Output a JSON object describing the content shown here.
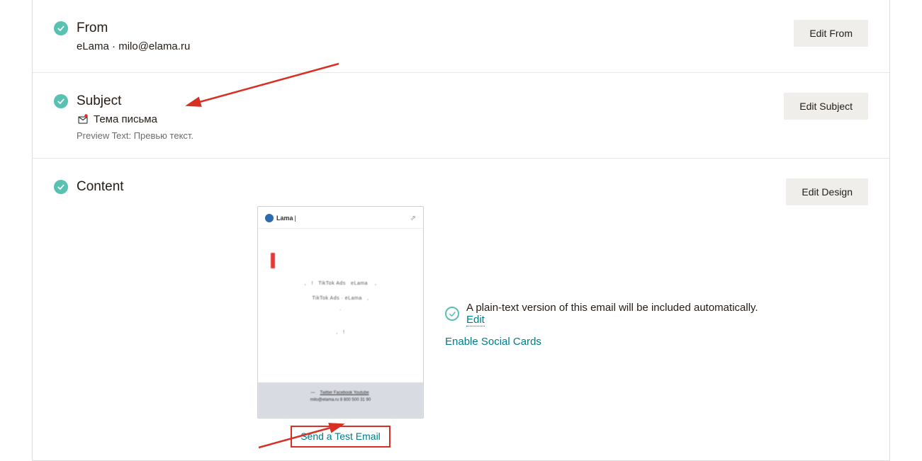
{
  "from": {
    "title": "From",
    "value": "eLama · milo@elama.ru",
    "button": "Edit From"
  },
  "subject": {
    "title": "Subject",
    "value": "Тема письма",
    "preview_label": "Preview Text:",
    "preview_value": "Превью текст.",
    "button": "Edit Subject"
  },
  "content": {
    "title": "Content",
    "button": "Edit Design",
    "test_link": "Send a Test Email",
    "plaintext_info": "A plain-text version of this email will be included automatically.",
    "edit_link": "Edit",
    "social_link": "Enable Social Cards",
    "thumb": {
      "brand": "Lama",
      "line1": "TikTok Ads",
      "line1b": "eLama",
      "line2": "TikTok Ads · eLama",
      "footer_links": "Twitter   Facebook   Youtube",
      "footer_contact": "milo@elama.ru   8 800 500 31 90"
    }
  }
}
